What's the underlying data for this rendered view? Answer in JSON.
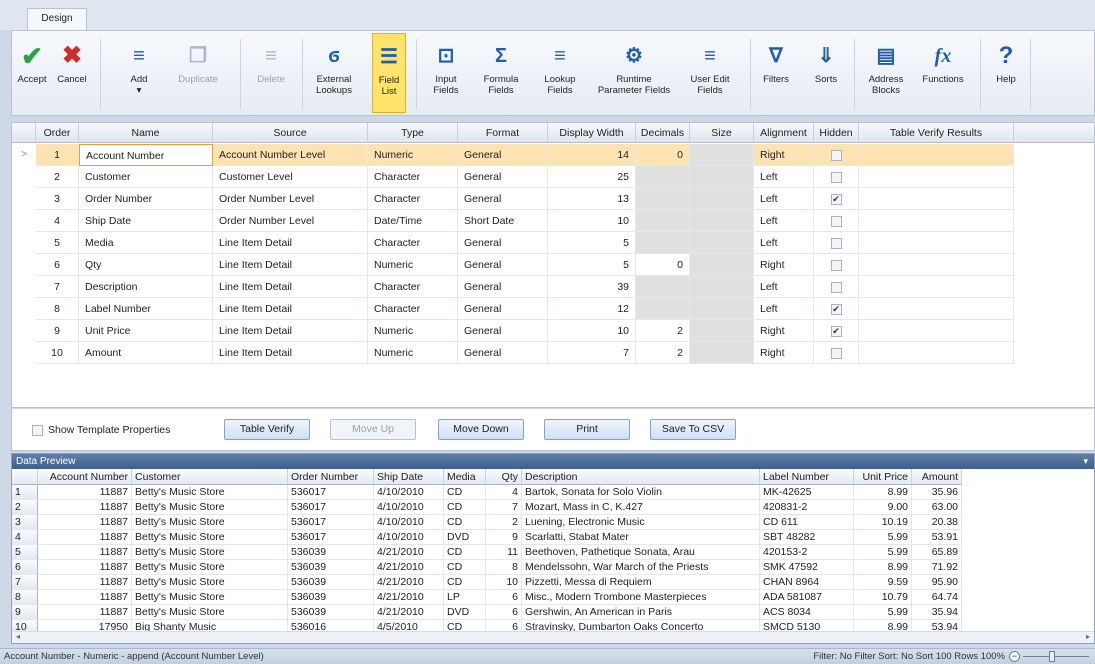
{
  "tabs": [
    {
      "label": "Design"
    }
  ],
  "ribbon": {
    "accept": "Accept",
    "cancel": "Cancel",
    "add": "Add",
    "duplicate": "Duplicate",
    "delete": "Delete",
    "external_lookups": "External\nLookups",
    "field_list": "Field\nList",
    "input_fields": "Input\nFields",
    "formula_fields": "Formula\nFields",
    "lookup_fields": "Lookup\nFields",
    "runtime_parameter_fields": "Runtime\nParameter Fields",
    "user_edit_fields": "User Edit\nFields",
    "filters": "Filters",
    "sorts": "Sorts",
    "address_blocks": "Address\nBlocks",
    "functions": "Functions",
    "help": "Help"
  },
  "grid": {
    "columns": [
      "Order",
      "Name",
      "Source",
      "Type",
      "Format",
      "Display Width",
      "Decimals",
      "Size",
      "Alignment",
      "Hidden",
      "Table Verify Results"
    ],
    "rows": [
      {
        "order": "1",
        "name": "Account Number",
        "source": "Account Number Level",
        "type": "Numeric",
        "format": "General",
        "width": "14",
        "decimals": "0",
        "alignment": "Right",
        "hidden": false
      },
      {
        "order": "2",
        "name": "Customer",
        "source": "Customer Level",
        "type": "Character",
        "format": "General",
        "width": "25",
        "decimals": "",
        "alignment": "Left",
        "hidden": false
      },
      {
        "order": "3",
        "name": "Order Number",
        "source": "Order Number Level",
        "type": "Character",
        "format": "General",
        "width": "13",
        "decimals": "",
        "alignment": "Left",
        "hidden": true
      },
      {
        "order": "4",
        "name": "Ship Date",
        "source": "Order Number Level",
        "type": "Date/Time",
        "format": "Short Date",
        "width": "10",
        "decimals": "",
        "alignment": "Left",
        "hidden": false
      },
      {
        "order": "5",
        "name": "Media",
        "source": "Line Item Detail",
        "type": "Character",
        "format": "General",
        "width": "5",
        "decimals": "",
        "alignment": "Left",
        "hidden": false
      },
      {
        "order": "6",
        "name": "Qty",
        "source": "Line Item Detail",
        "type": "Numeric",
        "format": "General",
        "width": "5",
        "decimals": "0",
        "alignment": "Right",
        "hidden": false
      },
      {
        "order": "7",
        "name": "Description",
        "source": "Line Item Detail",
        "type": "Character",
        "format": "General",
        "width": "39",
        "decimals": "",
        "alignment": "Left",
        "hidden": false
      },
      {
        "order": "8",
        "name": "Label Number",
        "source": "Line Item Detail",
        "type": "Character",
        "format": "General",
        "width": "12",
        "decimals": "",
        "alignment": "Left",
        "hidden": true
      },
      {
        "order": "9",
        "name": "Unit Price",
        "source": "Line Item Detail",
        "type": "Numeric",
        "format": "General",
        "width": "10",
        "decimals": "2",
        "alignment": "Right",
        "hidden": true
      },
      {
        "order": "10",
        "name": "Amount",
        "source": "Line Item Detail",
        "type": "Numeric",
        "format": "General",
        "width": "7",
        "decimals": "2",
        "alignment": "Right",
        "hidden": false
      }
    ]
  },
  "buttons": {
    "show_template_properties": "Show Template Properties",
    "table_verify": "Table Verify",
    "move_up": "Move Up",
    "move_down": "Move Down",
    "print": "Print",
    "save_to_csv": "Save To CSV"
  },
  "preview": {
    "title": "Data Preview",
    "columns": [
      "Account Number",
      "Customer",
      "Order Number",
      "Ship Date",
      "Media",
      "Qty",
      "Description",
      "Label Number",
      "Unit Price",
      "Amount"
    ],
    "rows": [
      [
        "1",
        "11887",
        "Betty's Music Store",
        "536017",
        "4/10/2010",
        "CD",
        "4",
        "Bartok, Sonata for Solo Violin",
        "MK-42625",
        "8.99",
        "35.96"
      ],
      [
        "2",
        "11887",
        "Betty's Music Store",
        "536017",
        "4/10/2010",
        "CD",
        "7",
        "Mozart, Mass in C, K.427",
        "420831-2",
        "9.00",
        "63.00"
      ],
      [
        "3",
        "11887",
        "Betty's Music Store",
        "536017",
        "4/10/2010",
        "CD",
        "2",
        "Luening, Electronic Music",
        "CD 611",
        "10.19",
        "20.38"
      ],
      [
        "4",
        "11887",
        "Betty's Music Store",
        "536017",
        "4/10/2010",
        "DVD",
        "9",
        "Scarlatti, Stabat Mater",
        "SBT 48282",
        "5.99",
        "53.91"
      ],
      [
        "5",
        "11887",
        "Betty's Music Store",
        "536039",
        "4/21/2010",
        "CD",
        "11",
        "Beethoven, Pathetique Sonata, Arau",
        "420153-2",
        "5.99",
        "65.89"
      ],
      [
        "6",
        "11887",
        "Betty's Music Store",
        "536039",
        "4/21/2010",
        "CD",
        "8",
        "Mendelssohn, War March of the Priests",
        "SMK 47592",
        "8.99",
        "71.92"
      ],
      [
        "7",
        "11887",
        "Betty's Music Store",
        "536039",
        "4/21/2010",
        "CD",
        "10",
        "Pizzetti, Messa di Requiem",
        "CHAN 8964",
        "9.59",
        "95.90"
      ],
      [
        "8",
        "11887",
        "Betty's Music Store",
        "536039",
        "4/21/2010",
        "LP",
        "6",
        "Misc., Modern Trombone Masterpieces",
        "ADA 581087",
        "10.79",
        "64.74"
      ],
      [
        "9",
        "11887",
        "Betty's Music Store",
        "536039",
        "4/21/2010",
        "DVD",
        "6",
        "Gershwin, An American in Paris",
        "ACS 8034",
        "5.99",
        "35.94"
      ],
      [
        "10",
        "17950",
        "Big Shanty Music",
        "536016",
        "4/5/2010",
        "CD",
        "6",
        "Stravinsky, Dumbarton Oaks Concerto",
        "SMCD 5130",
        "8.99",
        "53.94"
      ]
    ]
  },
  "status": {
    "left": "Account Number - Numeric - append (Account Number Level)",
    "right": "Filter: No Filter  Sort: No Sort   100 Rows   100%"
  },
  "colors": {
    "selected_row": "#fde3b3",
    "active_button": "#ffe36a",
    "preview_title": "#3f5f8c"
  }
}
